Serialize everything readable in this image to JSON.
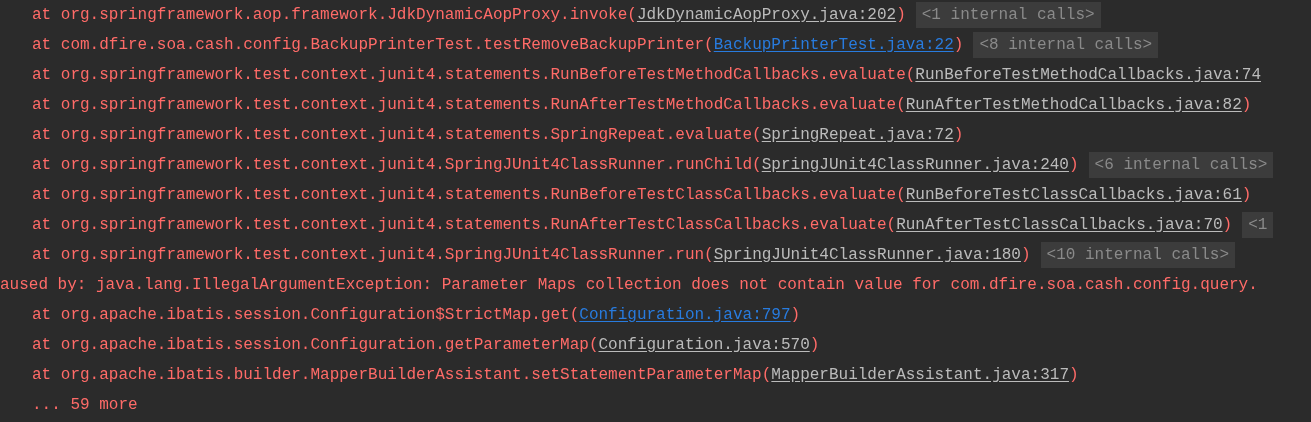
{
  "console": {
    "lines": [
      {
        "kind": "frame",
        "text": "at org.springframework.aop.framework.JdkDynamicAopProxy.invoke(",
        "link": "JdkDynamicAopProxy.java:202",
        "in_project": false,
        "close": ")",
        "folded": "<1 internal calls>"
      },
      {
        "kind": "frame",
        "text": "at com.dfire.soa.cash.config.BackupPrinterTest.testRemoveBackupPrinter(",
        "link": "BackupPrinterTest.java:22",
        "in_project": true,
        "close": ")",
        "folded": "<8 internal calls>"
      },
      {
        "kind": "frame",
        "text": "at org.springframework.test.context.junit4.statements.RunBeforeTestMethodCallbacks.evaluate(",
        "link": "RunBeforeTestMethodCallbacks.java:74",
        "in_project": false
      },
      {
        "kind": "frame",
        "text": "at org.springframework.test.context.junit4.statements.RunAfterTestMethodCallbacks.evaluate(",
        "link": "RunAfterTestMethodCallbacks.java:82",
        "in_project": false,
        "close": ")"
      },
      {
        "kind": "frame",
        "text": "at org.springframework.test.context.junit4.statements.SpringRepeat.evaluate(",
        "link": "SpringRepeat.java:72",
        "in_project": false,
        "close": ")"
      },
      {
        "kind": "frame",
        "text": "at org.springframework.test.context.junit4.SpringJUnit4ClassRunner.runChild(",
        "link": "SpringJUnit4ClassRunner.java:240",
        "in_project": false,
        "close": ")",
        "folded": "<6 internal calls>"
      },
      {
        "kind": "frame",
        "text": "at org.springframework.test.context.junit4.statements.RunBeforeTestClassCallbacks.evaluate(",
        "link": "RunBeforeTestClassCallbacks.java:61",
        "in_project": false,
        "close": ")"
      },
      {
        "kind": "frame",
        "text": "at org.springframework.test.context.junit4.statements.RunAfterTestClassCallbacks.evaluate(",
        "link": "RunAfterTestClassCallbacks.java:70",
        "in_project": false,
        "close": ")",
        "folded": "<1"
      },
      {
        "kind": "frame",
        "text": "at org.springframework.test.context.junit4.SpringJUnit4ClassRunner.run(",
        "link": "SpringJUnit4ClassRunner.java:180",
        "in_project": false,
        "close": ")",
        "folded": "<10 internal calls>"
      },
      {
        "kind": "caused",
        "text": "aused by: java.lang.IllegalArgumentException: Parameter Maps collection does not contain value for com.dfire.soa.cash.config.query."
      },
      {
        "kind": "frame",
        "text": "at org.apache.ibatis.session.Configuration$StrictMap.get(",
        "link": "Configuration.java:797",
        "in_project": true,
        "close": ")"
      },
      {
        "kind": "frame",
        "text": "at org.apache.ibatis.session.Configuration.getParameterMap(",
        "link": "Configuration.java:570",
        "in_project": false,
        "close": ")"
      },
      {
        "kind": "frame",
        "text": "at org.apache.ibatis.builder.MapperBuilderAssistant.setStatementParameterMap(",
        "link": "MapperBuilderAssistant.java:317",
        "in_project": false,
        "close": ")"
      },
      {
        "kind": "more",
        "text": "... 59 more"
      }
    ]
  }
}
